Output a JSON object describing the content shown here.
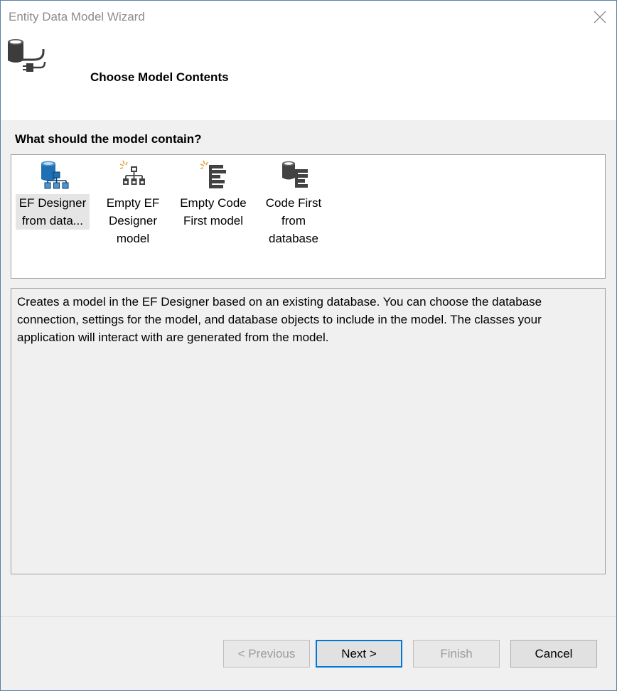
{
  "window": {
    "title": "Entity Data Model Wizard"
  },
  "header": {
    "title": "Choose Model Contents"
  },
  "question": "What should the model contain?",
  "options": [
    {
      "label": "EF Designer\nfrom data...",
      "icon": "ef-designer-from-database-icon",
      "selected": true
    },
    {
      "label": "Empty EF\nDesigner\nmodel",
      "icon": "empty-ef-designer-model-icon",
      "selected": false
    },
    {
      "label": "Empty Code\nFirst model",
      "icon": "empty-code-first-model-icon",
      "selected": false
    },
    {
      "label": "Code First\nfrom\ndatabase",
      "icon": "code-first-from-database-icon",
      "selected": false
    }
  ],
  "description": "Creates a model in the EF Designer based on an existing database. You can choose the database connection, settings for the model, and database objects to include in the model. The classes your application will interact with are generated from the model.",
  "buttons": {
    "previous": "< Previous",
    "next": "Next >",
    "finish": "Finish",
    "cancel": "Cancel"
  },
  "colors": {
    "accent": "#0078d7",
    "selection": "#e5e5e5",
    "icon_blue": "#1e6fb3",
    "icon_dark": "#424242",
    "spark": "#e8a33d"
  }
}
